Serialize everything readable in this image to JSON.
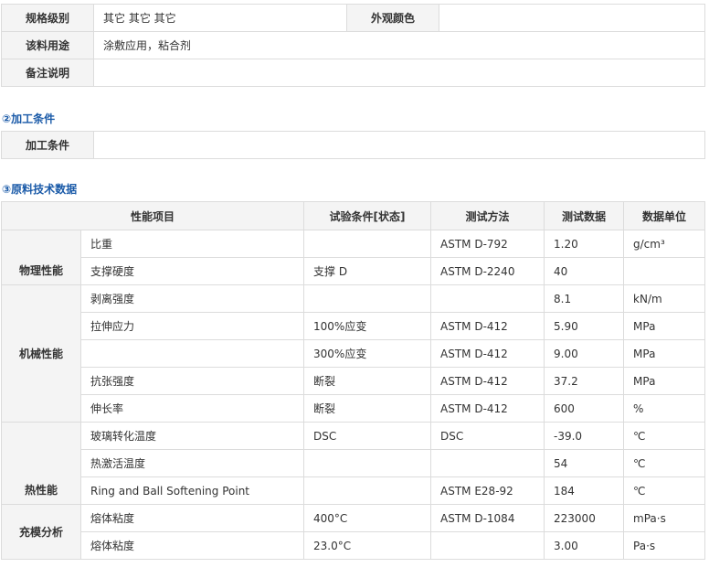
{
  "spec": {
    "grade_label": "规格级别",
    "grade_value": "其它 其它 其它",
    "appearance_label": "外观颜色",
    "appearance_value": "",
    "usage_label": "该料用途",
    "usage_value": "涂敷应用，粘合剂",
    "remarks_label": "备注说明",
    "remarks_value": ""
  },
  "processing": {
    "heading": "②加工条件",
    "label": "加工条件",
    "value": ""
  },
  "technical": {
    "heading": "③原料技术数据",
    "headers": [
      "性能项目",
      "试验条件[状态]",
      "测试方法",
      "测试数据",
      "数据单位"
    ],
    "categories": [
      "物理性能",
      "机械性能",
      "热性能",
      "充模分析"
    ],
    "rows": [
      {
        "prop": "比重",
        "cond": "",
        "method": "ASTM D-792",
        "value": "1.20",
        "unit": "g/cm³"
      },
      {
        "prop": "支撑硬度",
        "cond": "支撑 D",
        "method": "ASTM D-2240",
        "value": "40",
        "unit": ""
      },
      {
        "prop": "剥离强度",
        "cond": "",
        "method": "",
        "value": "8.1",
        "unit": "kN/m"
      },
      {
        "prop": "拉伸应力",
        "cond": "100%应变",
        "method": "ASTM D-412",
        "value": "5.90",
        "unit": "MPa"
      },
      {
        "prop": "",
        "cond": "300%应变",
        "method": "ASTM D-412",
        "value": "9.00",
        "unit": "MPa"
      },
      {
        "prop": "抗张强度",
        "cond": "断裂",
        "method": "ASTM D-412",
        "value": "37.2",
        "unit": "MPa"
      },
      {
        "prop": "伸长率",
        "cond": "断裂",
        "method": "ASTM D-412",
        "value": "600",
        "unit": "%"
      },
      {
        "prop": "玻璃转化温度",
        "cond": "DSC",
        "method": "DSC",
        "value": "-39.0",
        "unit": "℃"
      },
      {
        "prop": "热激活温度",
        "cond": "",
        "method": "",
        "value": "54",
        "unit": "℃"
      },
      {
        "prop": "Ring and Ball Softening Point",
        "cond": "",
        "method": "ASTM E28-92",
        "value": "184",
        "unit": "℃"
      },
      {
        "prop": "熔体粘度",
        "cond": "400°C",
        "method": "ASTM D-1084",
        "value": "223000",
        "unit": "mPa·s"
      },
      {
        "prop": "熔体粘度",
        "cond": "23.0°C",
        "method": "",
        "value": "3.00",
        "unit": "Pa·s"
      }
    ]
  }
}
